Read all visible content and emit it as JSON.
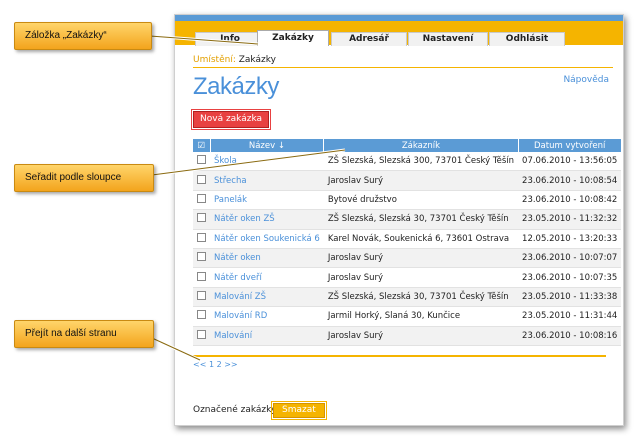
{
  "tabs": [
    {
      "label": "Info"
    },
    {
      "label": "Zakázky"
    },
    {
      "label": "Adresář"
    },
    {
      "label": "Nastavení"
    },
    {
      "label": "Odhlásit"
    }
  ],
  "breadcrumb": {
    "label": "Umístění:",
    "value": "Zakázky"
  },
  "page": {
    "title": "Zakázky",
    "help": "Nápověda",
    "new_button": "Nová zakázka"
  },
  "table": {
    "headers": {
      "check": "☑",
      "name": "Název ↓",
      "customer": "Zákazník",
      "date": "Datum vytvoření"
    },
    "rows": [
      {
        "name": "Škola",
        "customer": "ZŠ Slezská, Slezská 300, 73701 Český Těšín",
        "date": "07.06.2010 - 13:56:05"
      },
      {
        "name": "Střecha",
        "customer": "Jaroslav Surý",
        "date": "23.06.2010 - 10:08:54"
      },
      {
        "name": "Panelák",
        "customer": "Bytové družstvo",
        "date": "23.06.2010 - 10:08:42"
      },
      {
        "name": "Nátěr oken ZŠ",
        "customer": "ZŠ Slezská, Slezská 30, 73701 Český Těšín",
        "date": "23.05.2010 - 11:32:32"
      },
      {
        "name": "Nátěr oken Soukenická 6",
        "customer": "Karel Novák, Soukenická 6, 73601 Ostrava",
        "date": "12.05.2010 - 13:20:33"
      },
      {
        "name": "Nátěr oken",
        "customer": "Jaroslav Surý",
        "date": "23.06.2010 - 10:07:07"
      },
      {
        "name": "Nátěr dveří",
        "customer": "Jaroslav Surý",
        "date": "23.06.2010 - 10:07:35"
      },
      {
        "name": "Malování ZŠ",
        "customer": "ZŠ Slezská, Slezská 30, 73701 Český Těšín",
        "date": "23.05.2010 - 11:33:38"
      },
      {
        "name": "Malování RD",
        "customer": "Jarmil Horký, Slaná 30, Kunčice",
        "date": "23.05.2010 - 11:31:44"
      },
      {
        "name": "Malování",
        "customer": "Jaroslav Surý",
        "date": "23.06.2010 - 10:08:16"
      }
    ]
  },
  "pager": {
    "text": "<< 1 2 >>"
  },
  "bulk": {
    "label": "Označené zakázky:",
    "delete_button": "Smazat"
  },
  "callouts": {
    "tab": "Záložka „Zakázky“",
    "sort": "Seřadit podle sloupce",
    "next": "Přejít na další stranu"
  },
  "colors": {
    "accent_blue": "#5b9bd5",
    "accent_orange": "#f5b400",
    "danger_red": "#e84141"
  }
}
